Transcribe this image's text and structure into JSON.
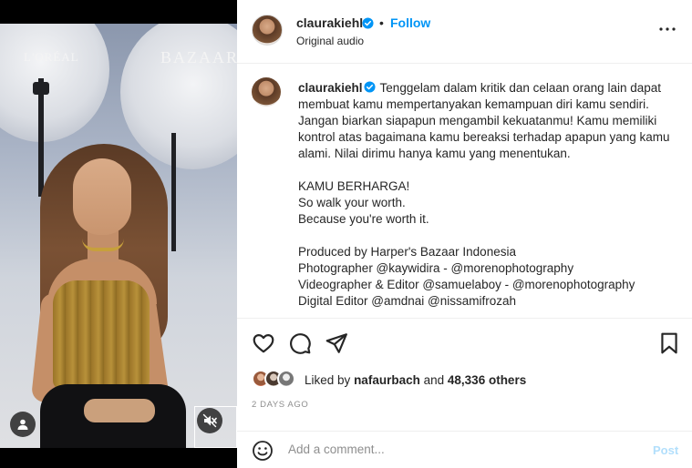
{
  "media": {
    "brand_left": "L'ORÉAL",
    "brand_right": "BAZAAR",
    "user_icon": "user-tag-icon",
    "mute_icon": "speaker-muted-icon"
  },
  "header": {
    "username": "claurakiehl",
    "separator": "•",
    "follow_label": "Follow",
    "subtitle": "Original audio",
    "more_icon": "more-horizontal-icon"
  },
  "post": {
    "username": "claurakiehl",
    "caption": "Tenggelam dalam kritik dan celaan orang lain dapat membuat kamu mempertanyakan kemampuan diri kamu sendiri. Jangan biarkan siapapun mengambil kekuatanmu! Kamu memiliki kontrol atas bagaimana kamu bereaksi terhadap apapun yang kamu alami. Nilai dirimu hanya kamu yang menentukan.\n\nKAMU BERHARGA!\nSo walk your worth.\nBecause you're worth it.\n\nProduced by Harper's Bazaar Indonesia\nPhotographer @kaywidira - @morenophotography\nVideographer & Editor @samuelaboy - @morenophotography\nDigital Editor @amdnai @nissamifrozah"
  },
  "actions": {
    "like_icon": "heart-icon",
    "comment_icon": "comment-icon",
    "share_icon": "paper-plane-icon",
    "save_icon": "bookmark-icon",
    "liked_prefix": "Liked by",
    "liked_user": "nafaurbach",
    "liked_and": "and",
    "liked_count": "48,336 others",
    "timestamp": "2 DAYS AGO"
  },
  "comment": {
    "emoji_icon": "emoji-icon",
    "placeholder": "Add a comment...",
    "post_label": "Post"
  },
  "colors": {
    "link": "#0095f6",
    "post_disabled": "#b2dffc",
    "verified": "#0095f6",
    "muted_text": "#8e8e8e"
  }
}
